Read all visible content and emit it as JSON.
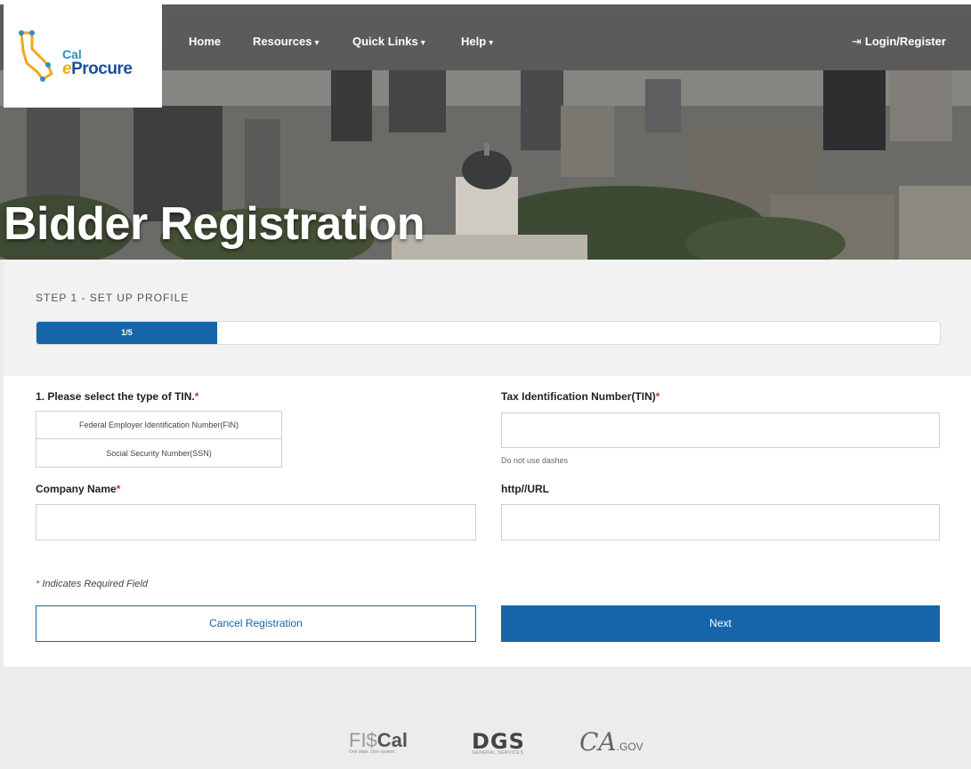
{
  "brand": {
    "logo_top": "Cal",
    "logo_e": "e",
    "logo_bottom": "Procure"
  },
  "nav": {
    "items": [
      {
        "label": "Home",
        "caret": ""
      },
      {
        "label": "Resources",
        "caret": "▾"
      },
      {
        "label": "Quick Links",
        "caret": "▾"
      },
      {
        "label": "Help",
        "caret": "▾"
      }
    ],
    "login_icon": "⇥",
    "login_label": "Login/Register"
  },
  "hero": {
    "title": "Bidder Registration"
  },
  "step": {
    "label": "STEP 1 - SET UP PROFILE",
    "progress_text": "1/5",
    "progress_fraction": 0.2
  },
  "form": {
    "tin_type_label": "1. Please select the type of TIN.",
    "tin_options": [
      "Federal Employer Identification Number(FIN)",
      "Social Security Number(SSN)"
    ],
    "tin_label": "Tax Identification Number(TIN)",
    "tin_value": "",
    "tin_hint": "Do not use dashes",
    "company_label": "Company Name",
    "company_value": "",
    "url_label": "http//URL",
    "url_value": "",
    "required_asterisk": "*",
    "required_note": " Indicates Required Field",
    "cancel_label": "Cancel Registration",
    "next_label": "Next"
  },
  "footer": {
    "logos": [
      {
        "name": "fiscal-logo",
        "text_thin": "FI$",
        "text_bold": "Cal",
        "tagline": "One state. One system."
      },
      {
        "name": "dgs-logo",
        "text": "DGS",
        "tagline": "GENERAL SERVICES"
      },
      {
        "name": "ca-gov-logo",
        "script": "CA",
        "text": ".GOV"
      }
    ]
  },
  "colors": {
    "accent": "#1765a8",
    "nav_bg": "#585858",
    "required": "#c0392b"
  }
}
